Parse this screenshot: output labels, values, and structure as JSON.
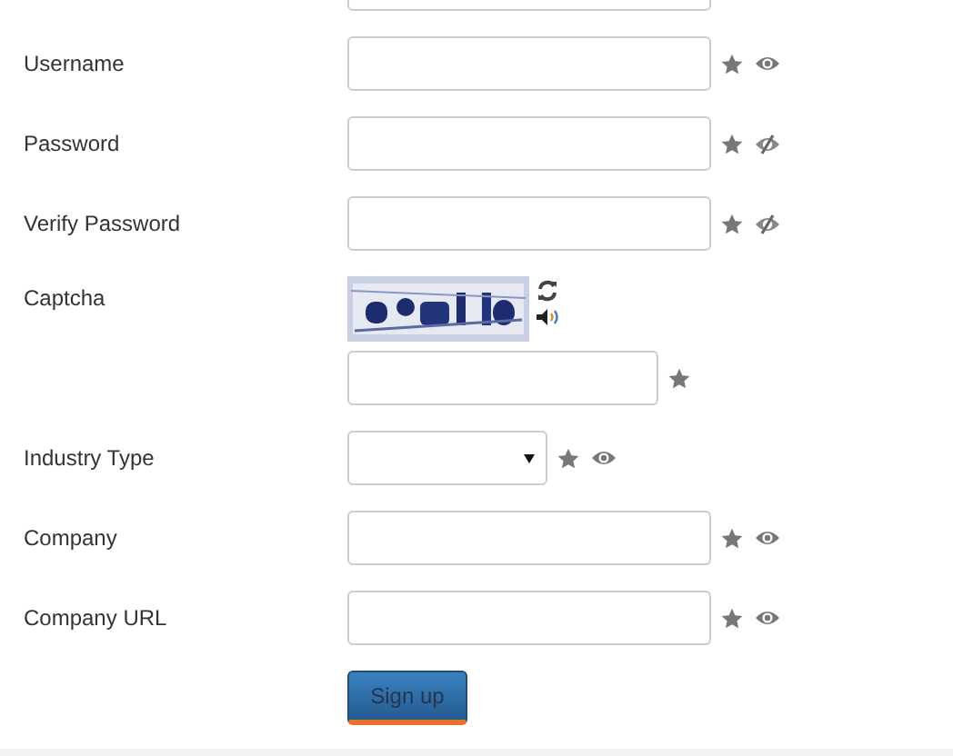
{
  "fields": [
    {
      "kind": "partial"
    },
    {
      "label": "Username",
      "kind": "text",
      "icons": [
        {
          "kind": "star"
        },
        {
          "kind": "eye"
        }
      ]
    },
    {
      "label": "Password",
      "kind": "text",
      "icons": [
        {
          "kind": "star"
        },
        {
          "kind": "eye-slash"
        }
      ]
    },
    {
      "label": "Verify Password",
      "kind": "text",
      "icons": [
        {
          "kind": "star"
        },
        {
          "kind": "eye-slash"
        }
      ]
    },
    {
      "label": "Captcha",
      "kind": "captcha",
      "icons": [
        {
          "kind": "star"
        }
      ]
    },
    {
      "label": "Industry Type",
      "kind": "select",
      "icons": [
        {
          "kind": "star"
        },
        {
          "kind": "eye"
        }
      ]
    },
    {
      "label": "Company",
      "kind": "text",
      "icons": [
        {
          "kind": "star"
        },
        {
          "kind": "eye"
        }
      ]
    },
    {
      "label": "Company URL",
      "kind": "text",
      "icons": [
        {
          "kind": "star"
        },
        {
          "kind": "eye"
        }
      ]
    }
  ],
  "submit": {
    "label": "Sign up"
  }
}
